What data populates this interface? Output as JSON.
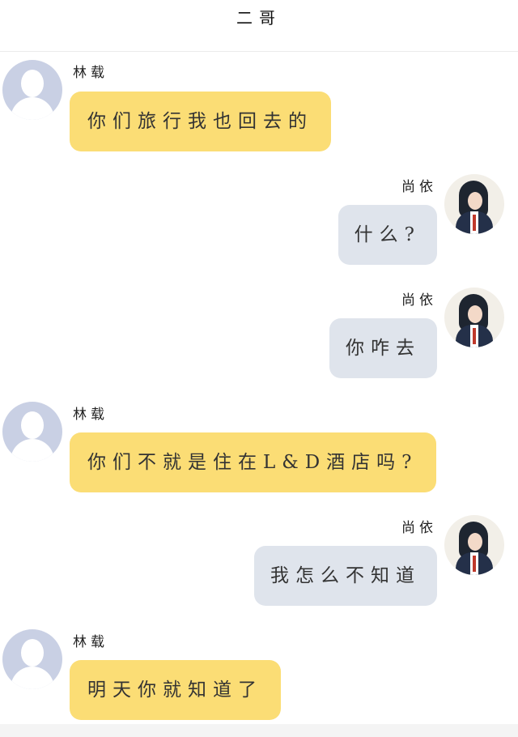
{
  "header": {
    "title": "二哥"
  },
  "messages": [
    {
      "side": "left",
      "sender": "林载",
      "text": "你们旅行我也回去的"
    },
    {
      "side": "right",
      "sender": "尚依",
      "text": "什么?"
    },
    {
      "side": "right",
      "sender": "尚依",
      "text": "你咋去"
    },
    {
      "side": "left",
      "sender": "林载",
      "text": "你们不就是住在L&D酒店吗?"
    },
    {
      "side": "right",
      "sender": "尚依",
      "text": "我怎么不知道"
    },
    {
      "side": "left",
      "sender": "林载",
      "text": "明天你就知道了"
    }
  ],
  "colors": {
    "left_bubble": "#fbdd75",
    "right_bubble": "#dfe4ec",
    "default_avatar": "#c9d0e4"
  },
  "icons": {
    "left_avatar": "default-user-avatar-icon",
    "right_avatar": "girl-photo-avatar"
  }
}
